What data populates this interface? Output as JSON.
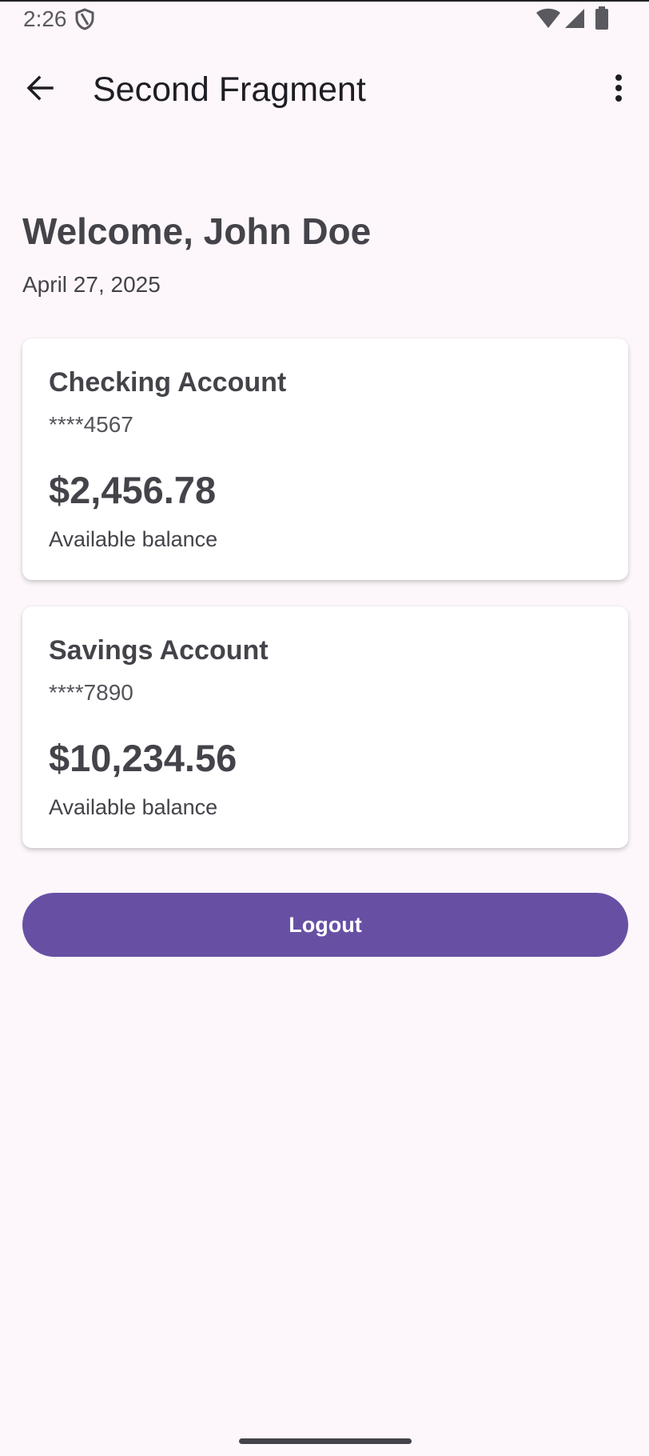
{
  "status_bar": {
    "time": "2:26",
    "icons": [
      "shield-icon",
      "wifi-icon",
      "signal-icon",
      "battery-icon"
    ]
  },
  "app_bar": {
    "title": "Second Fragment",
    "back_icon": "arrow-back-icon",
    "menu_icon": "more-vert-icon"
  },
  "welcome": {
    "title": "Welcome, John Doe",
    "date": "April 27, 2025"
  },
  "accounts": [
    {
      "name": "Checking Account",
      "number": "****4567",
      "balance": "$2,456.78",
      "balance_label": "Available balance"
    },
    {
      "name": "Savings Account",
      "number": "****7890",
      "balance": "$10,234.56",
      "balance_label": "Available balance"
    }
  ],
  "logout": {
    "label": "Logout"
  },
  "colors": {
    "background": "#fdf7fb",
    "primary": "#6750a4",
    "text": "#45434a",
    "card": "#ffffff"
  }
}
